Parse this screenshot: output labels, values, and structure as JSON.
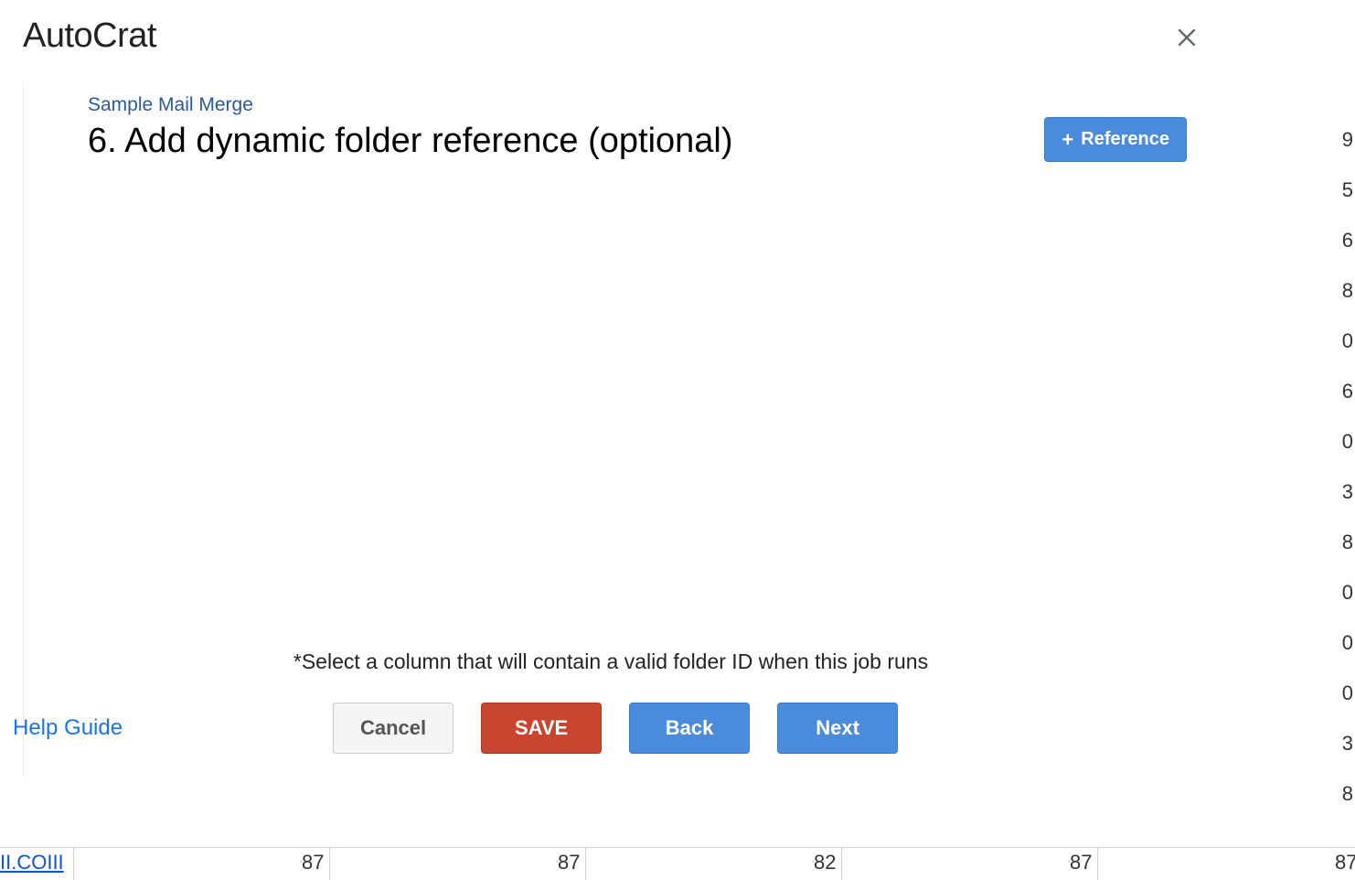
{
  "app": {
    "title": "AutoCrat"
  },
  "header": {
    "subtitle": "Sample Mail Merge",
    "step_title": "6. Add dynamic folder reference (optional)",
    "reference_button_label": "Reference"
  },
  "body": {
    "hint": "*Select a column that will contain a valid folder ID when this job runs"
  },
  "footer": {
    "help_link": "Help Guide",
    "cancel": "Cancel",
    "save": "SAVE",
    "back": "Back",
    "next": "Next"
  },
  "background": {
    "partial_link": "II.COIII",
    "cells": [
      "87",
      "87",
      "82",
      "87",
      "87"
    ],
    "right_col_fragments": [
      "9",
      "5",
      "6",
      "8",
      "0",
      "6",
      "0",
      "3",
      "8",
      "0",
      "0",
      "0",
      "3",
      "8"
    ]
  }
}
